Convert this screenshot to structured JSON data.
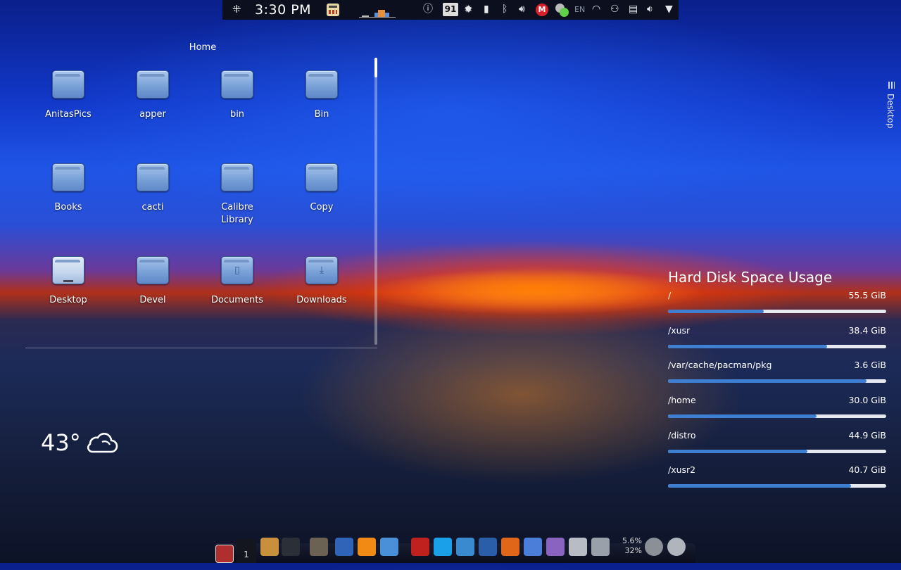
{
  "top_panel": {
    "time": "3:30 PM",
    "updates_badge": "91",
    "mail_letter": "M",
    "keyboard_layout": "EN"
  },
  "folder_view": {
    "title": "Home",
    "items": [
      {
        "label": "AnitasPics",
        "icon": "folder-icon"
      },
      {
        "label": "apper",
        "icon": "folder-icon"
      },
      {
        "label": "bin",
        "icon": "folder-icon"
      },
      {
        "label": "Bin",
        "icon": "folder-icon"
      },
      {
        "label": "Books",
        "icon": "folder-icon"
      },
      {
        "label": "cacti",
        "icon": "folder-icon"
      },
      {
        "label": "Calibre Library",
        "icon": "folder-icon"
      },
      {
        "label": "Copy",
        "icon": "folder-icon"
      },
      {
        "label": "Desktop",
        "icon": "desktop-folder-icon"
      },
      {
        "label": "Devel",
        "icon": "folder-icon"
      },
      {
        "label": "Documents",
        "icon": "documents-folder-icon"
      },
      {
        "label": "Downloads",
        "icon": "downloads-folder-icon"
      }
    ]
  },
  "weather": {
    "temperature": "43°",
    "condition_icon": "cloud-icon"
  },
  "toolbox": {
    "label": "Desktop"
  },
  "disk_usage": {
    "title": "Hard Disk Space Usage",
    "accent": "#3f7fd2",
    "partitions": [
      {
        "path": "/",
        "size": "55.5 GiB",
        "used_fraction": 0.44
      },
      {
        "path": "/xusr",
        "size": "38.4 GiB",
        "used_fraction": 0.73
      },
      {
        "path": "/var/cache/pacman/pkg",
        "size": "3.6 GiB",
        "used_fraction": 0.91
      },
      {
        "path": "/home",
        "size": "30.0 GiB",
        "used_fraction": 0.68
      },
      {
        "path": "/distro",
        "size": "44.9 GiB",
        "used_fraction": 0.64
      },
      {
        "path": "/xusr2",
        "size": "40.7 GiB",
        "used_fraction": 0.84
      }
    ]
  },
  "dock": {
    "pager_number": "1",
    "cpu_percent": "5.6%",
    "mem_percent": "32%",
    "apps": [
      {
        "name": "file-manager-icon",
        "color": "#c8903c"
      },
      {
        "name": "terminal-icon",
        "color": "#2b2f38"
      },
      {
        "name": "gimp-icon",
        "color": "#6b6253"
      },
      {
        "name": "media-player-icon",
        "color": "#2f64b8"
      },
      {
        "name": "vlc-icon",
        "color": "#f08a14"
      },
      {
        "name": "text-editor-icon",
        "color": "#4a90d8"
      },
      {
        "name": "filezilla-icon",
        "color": "#c0201e"
      },
      {
        "name": "skype-icon",
        "color": "#1aa0e8"
      },
      {
        "name": "system-monitor-icon",
        "color": "#3a8ad0"
      },
      {
        "name": "thunderbird-icon",
        "color": "#2a5ea8"
      },
      {
        "name": "firefox-icon",
        "color": "#e0661a"
      },
      {
        "name": "chromium-icon",
        "color": "#4a7ed8"
      },
      {
        "name": "pidgin-icon",
        "color": "#8a62c0"
      },
      {
        "name": "package-installer-icon",
        "color": "#b8bcc4"
      },
      {
        "name": "settings-wrench-icon",
        "color": "#9aa0aa"
      },
      {
        "name": "power-icon",
        "color": "#8a8f98"
      },
      {
        "name": "trash-icon",
        "color": "#b0b4bc"
      }
    ]
  }
}
